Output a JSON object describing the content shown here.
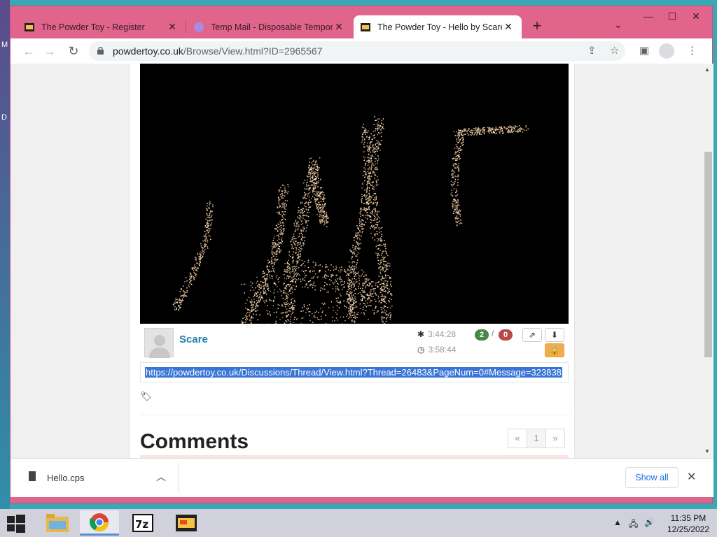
{
  "browser": {
    "tabs": [
      {
        "title": "The Powder Toy - Register",
        "active": false
      },
      {
        "title": "Temp Mail - Disposable Temporary",
        "active": false
      },
      {
        "title": "The Powder Toy - Hello by Scare",
        "active": true
      }
    ],
    "new_tab_label": "+",
    "url_host": "powdertoy.co.uk",
    "url_path": "/Browse/View.html?ID=2965567"
  },
  "save": {
    "author": "Scare",
    "created_time": "3:44:28",
    "updated_time": "3:58:44",
    "votes_up": "2",
    "votes_down": "0",
    "vote_separator": "/",
    "link": "https://powdertoy.co.uk/Discussions/Thread/View.html?Thread=26483&PageNum=0#Message=323838"
  },
  "comments": {
    "title": "Comments",
    "pager": {
      "prev": "«",
      "page": "1",
      "next": "»"
    }
  },
  "download_bar": {
    "file_name": "Hello.cps",
    "show_all_label": "Show all"
  },
  "taskbar": {
    "time": "11:35 PM",
    "date": "12/25/2022"
  },
  "desktop": {
    "edge_letters": [
      "M",
      "D"
    ]
  },
  "colors": {
    "browser_frame": "#e0648c",
    "link_blue": "#1f7fa6",
    "vote_up": "#468847",
    "vote_down": "#b94a48",
    "selection": "#3875d7"
  }
}
